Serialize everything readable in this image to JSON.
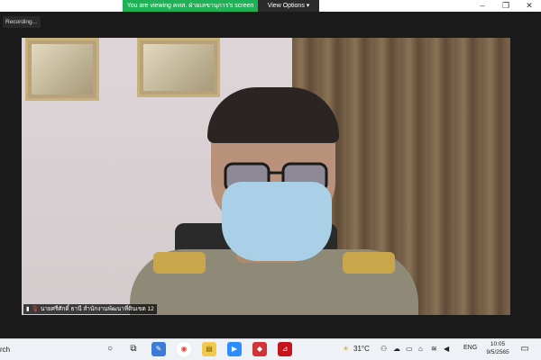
{
  "zoom": {
    "viewing_banner": "You are viewing คทส. ฝ่ายเลขานุการ's screen",
    "view_options": "View Options ▾",
    "recording": "Recording..."
  },
  "window_controls": [
    "–",
    "❐",
    "✕"
  ],
  "participant": {
    "name": "นายศรีศักดิ์ ธานี สำนักงานพัฒนาที่ดินเขต 12"
  },
  "taskbar": {
    "search_fragment": "rch",
    "weather": "31°C",
    "language": "ENG",
    "time": "10:05",
    "date": "9/5/2565"
  },
  "colors": {
    "banner_green": "#1fb155",
    "word_red": "#d13438",
    "pdf_red": "#c4151c",
    "zoom_blue": "#2d8cff"
  }
}
